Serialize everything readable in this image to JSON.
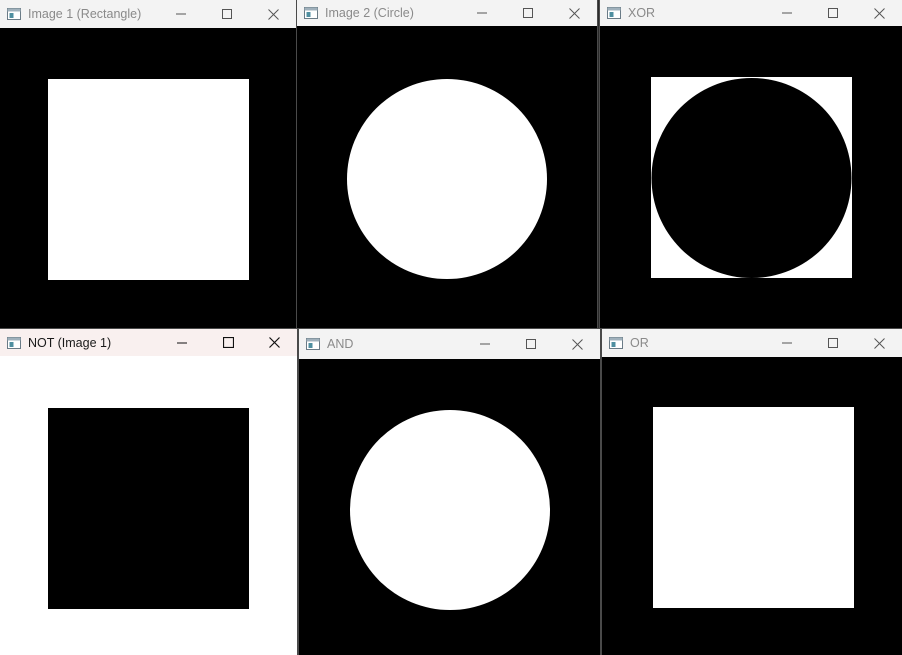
{
  "colors": {
    "titlebar_bg": "#f3f3f3",
    "titlebar_active_bg": "#f9f0ef",
    "image_black": "#000000",
    "image_white": "#ffffff"
  },
  "window_controls": [
    "minimize-icon",
    "maximize-icon",
    "close-icon"
  ],
  "windows": [
    {
      "title": "Image 1 (Rectangle)",
      "operation": "input-rectangle"
    },
    {
      "title": "Image 2 (Circle)",
      "operation": "input-circle"
    },
    {
      "title": "XOR",
      "operation": "xor"
    },
    {
      "title": "NOT (Image 1)",
      "operation": "not",
      "active": true
    },
    {
      "title": "AND",
      "operation": "and"
    },
    {
      "title": "OR",
      "operation": "or"
    }
  ]
}
